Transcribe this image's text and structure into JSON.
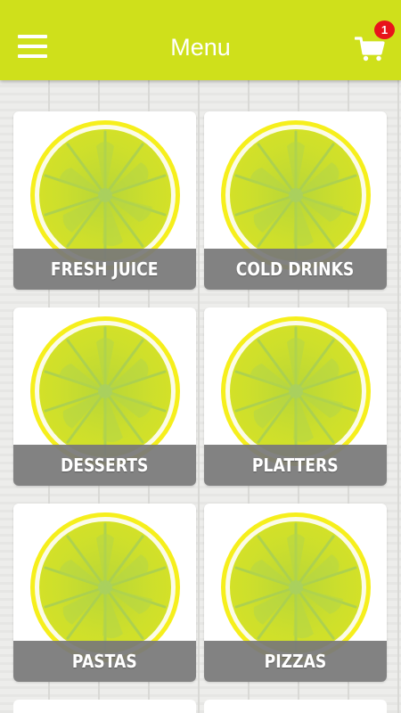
{
  "header": {
    "title": "Menu",
    "cart_count": "1"
  },
  "colors": {
    "brand": "#cfe01b",
    "badge": "#e8141b",
    "label_overlay": "#787878",
    "lemon_flesh": "#c9dc2c",
    "lemon_rind": "#f5ef1e"
  },
  "icons": {
    "menu": "hamburger-menu-icon",
    "cart": "shopping-cart-icon",
    "tile": "lime-slice-icon"
  },
  "categories": [
    {
      "label": "FRESH JUICE"
    },
    {
      "label": "COLD DRINKS"
    },
    {
      "label": "DESSERTS"
    },
    {
      "label": "PLATTERS"
    },
    {
      "label": "PASTAS"
    },
    {
      "label": "PIZZAS"
    }
  ]
}
